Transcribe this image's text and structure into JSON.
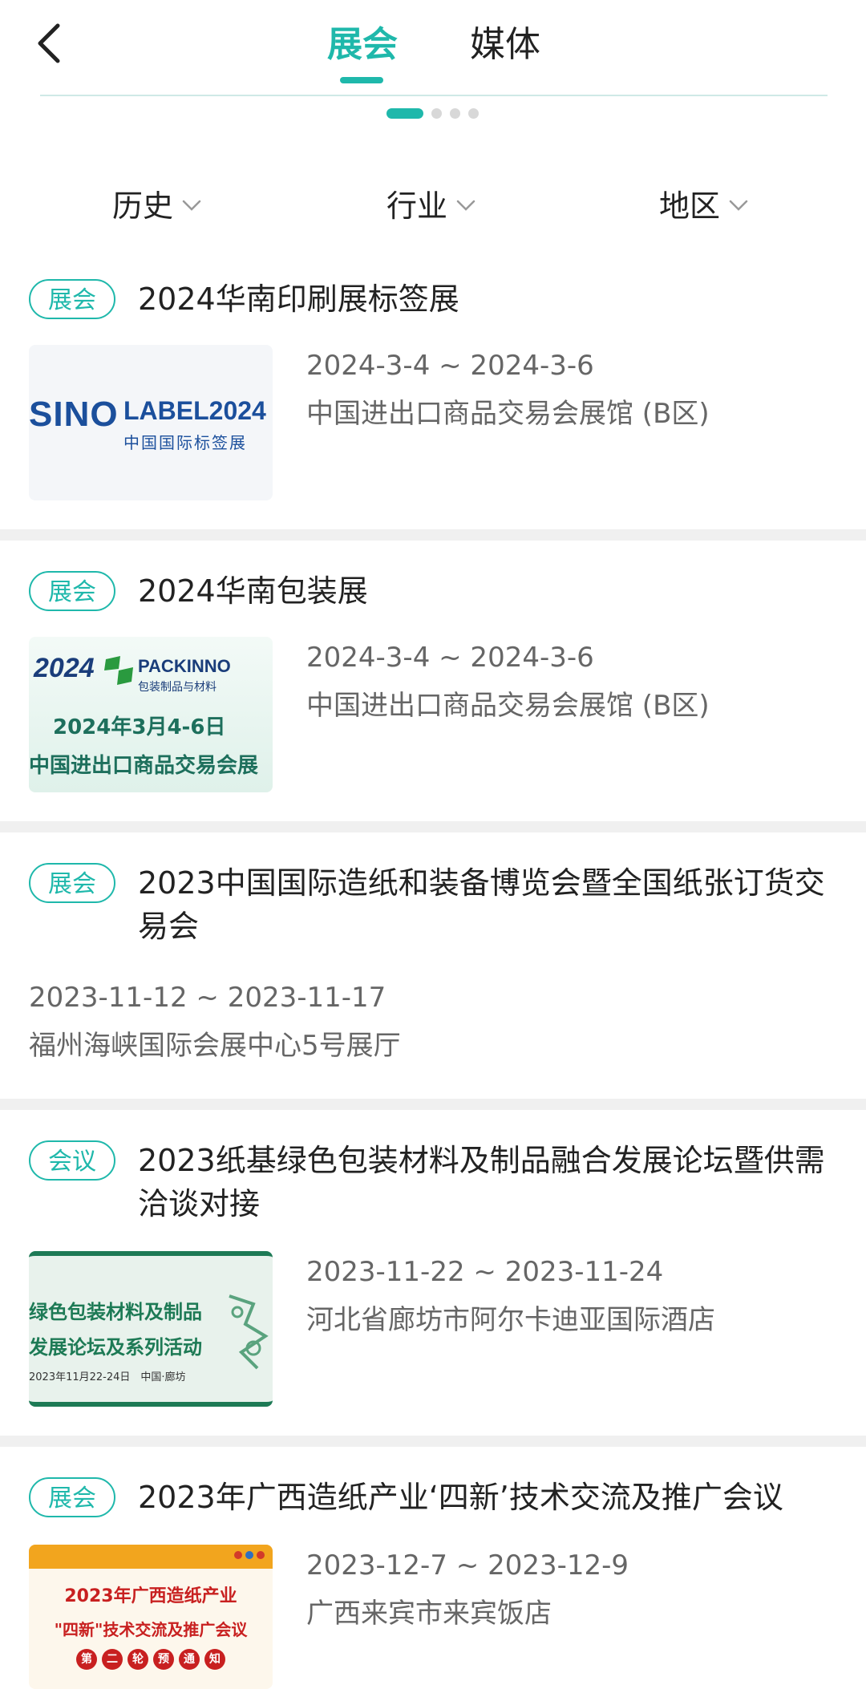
{
  "header": {
    "tabs": [
      "展会",
      "媒体"
    ]
  },
  "filters": [
    "历史",
    "行业",
    "地区"
  ],
  "events": [
    {
      "tag": "展会",
      "title": "2024华南印刷展标签展",
      "date": "2024-3-4 ~ 2024-3-6",
      "venue": "中国进出口商品交易会展馆 (B区)",
      "thumb": {
        "brand_left": "SINO",
        "brand_right": "LABEL2024",
        "subtitle": "中国国际标签展"
      }
    },
    {
      "tag": "展会",
      "title": "2024华南包装展",
      "date": "2024-3-4 ~ 2024-3-6",
      "venue": "中国进出口商品交易会展馆 (B区)",
      "thumb": {
        "year": "2024",
        "brand": "PACKINNO",
        "brand_sub": "包装制品与材料",
        "dates": "2024年3月4-6日",
        "place": "中国进出口商品交易会展"
      }
    },
    {
      "tag": "展会",
      "title": "2023中国国际造纸和装备博览会暨全国纸张订货交易会",
      "date": "2023-11-12 ~ 2023-11-17",
      "venue": "福州海峡国际会展中心5号展厅"
    },
    {
      "tag": "会议",
      "title": "2023纸基绿色包装材料及制品融合发展论坛暨供需洽谈对接",
      "date": "2023-11-22 ~ 2023-11-24",
      "venue": "河北省廊坊市阿尔卡迪亚国际酒店",
      "thumb": {
        "line1": "绿色包装材料及制品",
        "line2": "发展论坛及系列活动",
        "line3": "2023年11月22-24日　中国·廊坊"
      }
    },
    {
      "tag": "展会",
      "title": "2023年广西造纸产业‘四新’技术交流及推广会议",
      "date": "2023-12-7 ~ 2023-12-9",
      "venue": "广西来宾市来宾饭店",
      "thumb": {
        "line1": "2023年广西造纸产业",
        "line2": "\"四新\"技术交流及推广会议",
        "notice": [
          "第",
          "二",
          "轮",
          "预",
          "通",
          "知"
        ]
      }
    }
  ],
  "colors": {
    "accent": "#1fb8ab",
    "separator": "#f0f0f0",
    "text": "#222222",
    "muted": "#666666"
  }
}
